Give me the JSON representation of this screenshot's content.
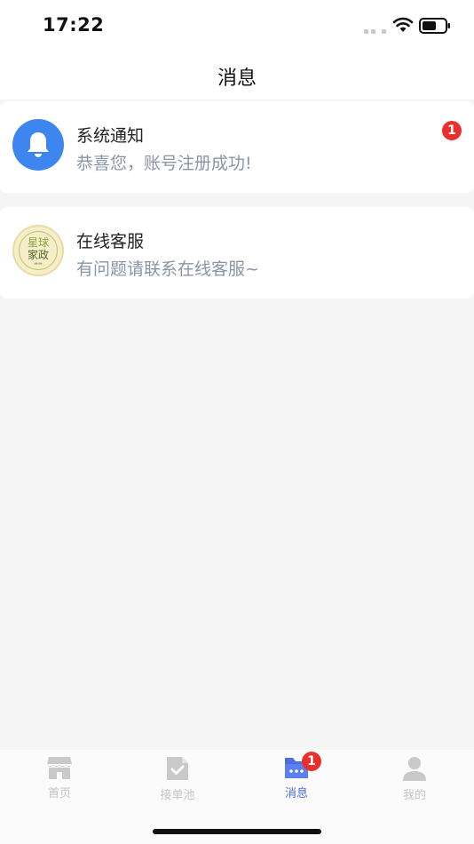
{
  "status_bar": {
    "time": "17:22"
  },
  "header": {
    "title": "消息"
  },
  "messages": [
    {
      "title": "系统通知",
      "subtitle": "恭喜您，账号注册成功!",
      "icon": "bell-icon",
      "badge": "1"
    },
    {
      "title": "在线客服",
      "subtitle": "有问题请联系在线客服~",
      "icon": "brand-logo",
      "logo_text": [
        "星球",
        "家政"
      ]
    }
  ],
  "tabbar": {
    "items": [
      {
        "label": "首页",
        "icon": "store-icon",
        "active": false
      },
      {
        "label": "接单池",
        "icon": "document-check-icon",
        "active": false
      },
      {
        "label": "消息",
        "icon": "message-folder-icon",
        "active": true,
        "badge": "1"
      },
      {
        "label": "我的",
        "icon": "user-icon",
        "active": false
      }
    ]
  },
  "colors": {
    "accent": "#4a6ee0",
    "bell_bg": "#3d86f0",
    "badge": "#e8312c",
    "subtitle": "#8a94a6",
    "inactive_tab": "#c3c3c3",
    "background": "#f5f5f5"
  }
}
